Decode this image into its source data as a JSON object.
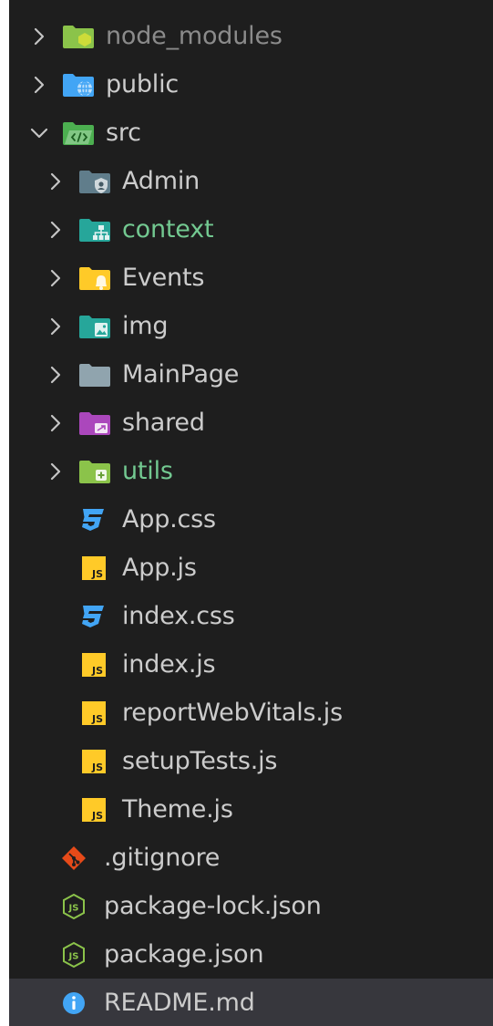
{
  "explorer": {
    "items": [
      {
        "label": "node_modules",
        "kind": "folder",
        "expanded": false,
        "icon": "folder-node-icon",
        "text_color": "#8b8b8b",
        "icon_color": "#8bc34a"
      },
      {
        "label": "public",
        "kind": "folder",
        "expanded": false,
        "icon": "folder-public-icon",
        "text_color": "#cccccc",
        "icon_color": "#42a5f5"
      },
      {
        "label": "src",
        "kind": "folder",
        "expanded": true,
        "icon": "folder-src-icon",
        "text_color": "#cccccc",
        "icon_color": "#4caf50"
      },
      {
        "label": "Admin",
        "kind": "folder",
        "expanded": false,
        "icon": "folder-admin-icon",
        "text_color": "#cccccc",
        "icon_color": "#607d8b"
      },
      {
        "label": "context",
        "kind": "folder",
        "expanded": false,
        "icon": "folder-context-icon",
        "text_color": "#73c991",
        "icon_color": "#26a69a"
      },
      {
        "label": "Events",
        "kind": "folder",
        "expanded": false,
        "icon": "folder-events-icon",
        "text_color": "#cccccc",
        "icon_color": "#ffca28"
      },
      {
        "label": "img",
        "kind": "folder",
        "expanded": false,
        "icon": "folder-images-icon",
        "text_color": "#cccccc",
        "icon_color": "#26a69a"
      },
      {
        "label": "MainPage",
        "kind": "folder",
        "expanded": false,
        "icon": "folder-icon",
        "text_color": "#cccccc",
        "icon_color": "#90a4ae"
      },
      {
        "label": "shared",
        "kind": "folder",
        "expanded": false,
        "icon": "folder-shared-icon",
        "text_color": "#cccccc",
        "icon_color": "#ab47bc"
      },
      {
        "label": "utils",
        "kind": "folder",
        "expanded": false,
        "icon": "folder-utils-icon",
        "text_color": "#73c991",
        "icon_color": "#8bc34a"
      },
      {
        "label": "App.css",
        "kind": "file",
        "icon": "css-icon",
        "text_color": "#cccccc",
        "icon_color": "#42a5f5"
      },
      {
        "label": "App.js",
        "kind": "file",
        "icon": "javascript-icon",
        "text_color": "#cccccc",
        "icon_color": "#ffca28"
      },
      {
        "label": "index.css",
        "kind": "file",
        "icon": "css-icon",
        "text_color": "#cccccc",
        "icon_color": "#42a5f5"
      },
      {
        "label": "index.js",
        "kind": "file",
        "icon": "javascript-icon",
        "text_color": "#cccccc",
        "icon_color": "#ffca28"
      },
      {
        "label": "reportWebVitals.js",
        "kind": "file",
        "icon": "javascript-icon",
        "text_color": "#cccccc",
        "icon_color": "#ffca28"
      },
      {
        "label": "setupTests.js",
        "kind": "file",
        "icon": "javascript-icon",
        "text_color": "#cccccc",
        "icon_color": "#ffca28"
      },
      {
        "label": "Theme.js",
        "kind": "file",
        "icon": "javascript-icon",
        "text_color": "#cccccc",
        "icon_color": "#ffca28"
      },
      {
        "label": ".gitignore",
        "kind": "file",
        "icon": "git-icon",
        "text_color": "#cccccc",
        "icon_color": "#e64a19"
      },
      {
        "label": "package-lock.json",
        "kind": "file",
        "icon": "nodejs-icon",
        "text_color": "#cccccc",
        "icon_color": "#8bc34a"
      },
      {
        "label": "package.json",
        "kind": "file",
        "icon": "nodejs-icon",
        "text_color": "#cccccc",
        "icon_color": "#8bc34a"
      },
      {
        "label": "README.md",
        "kind": "file",
        "icon": "info-icon",
        "text_color": "#cccccc",
        "icon_color": "#42a5f5",
        "selected": true
      }
    ]
  }
}
